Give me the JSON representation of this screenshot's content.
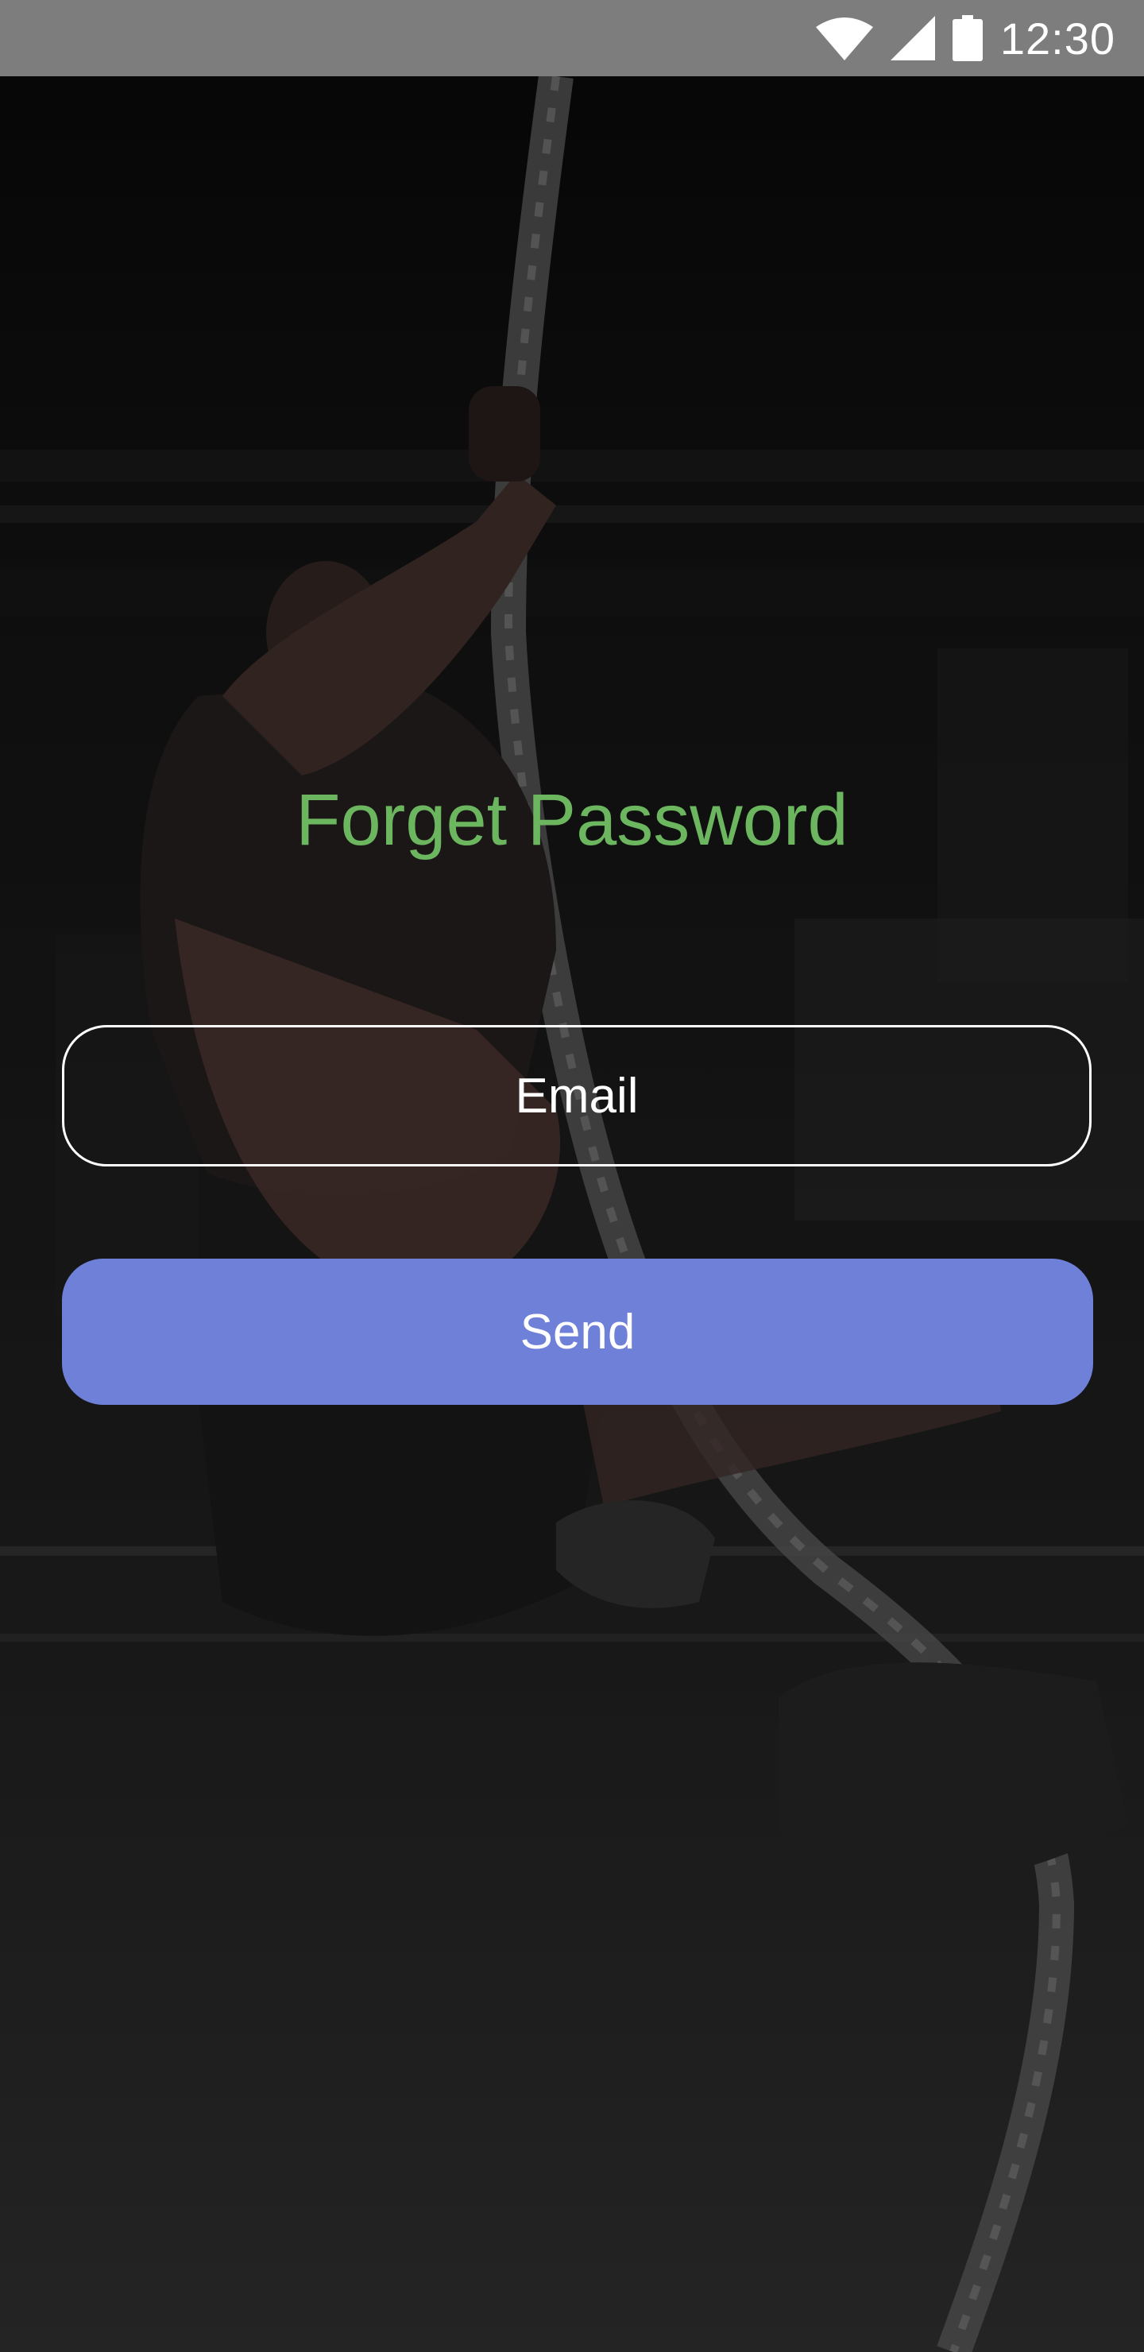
{
  "status_bar": {
    "time": "12:30",
    "icons": [
      "wifi-icon",
      "cellular-signal-icon",
      "battery-icon"
    ],
    "background": "#7d7d7d"
  },
  "form": {
    "title": "Forget Password",
    "email_placeholder": "Email",
    "send_label": "Send"
  },
  "colors": {
    "title": "#6bb65f",
    "button": "#6f80d8",
    "field_border": "#ffffff"
  },
  "background_image": "climber-on-rope-photo"
}
